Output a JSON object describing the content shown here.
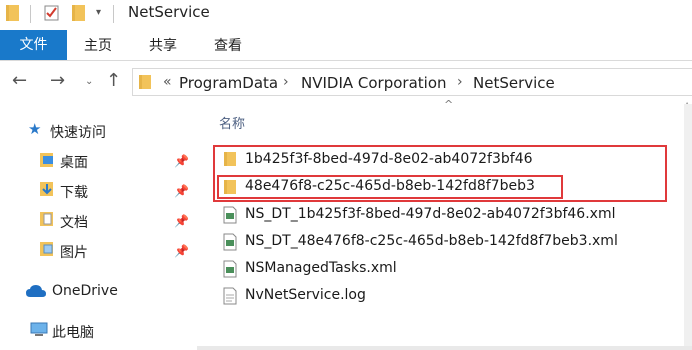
{
  "window": {
    "title": "NetService"
  },
  "ribbon": {
    "tabs": [
      {
        "label": "文件",
        "active": true
      },
      {
        "label": "主页"
      },
      {
        "label": "共享"
      },
      {
        "label": "查看"
      }
    ]
  },
  "address": {
    "overflow": "«",
    "crumbs": [
      "ProgramData",
      "NVIDIA Corporation",
      "NetService"
    ]
  },
  "nav_pane": {
    "quick_access": "快速访问",
    "pinned": [
      "桌面",
      "下载",
      "文档",
      "图片"
    ],
    "onedrive": "OneDrive",
    "this_pc": "此电脑"
  },
  "file_list": {
    "column_header": "名称",
    "items": [
      {
        "name": "1b425f3f-8bed-497d-8e02-ab4072f3bf46",
        "type": "folder",
        "highlighted": true
      },
      {
        "name": "48e476f8-c25c-465d-b8eb-142fd8f7beb3",
        "type": "folder",
        "highlighted": true
      },
      {
        "name": "NS_DT_1b425f3f-8bed-497d-8e02-ab4072f3bf46.xml",
        "type": "xml"
      },
      {
        "name": "NS_DT_48e476f8-c25c-465d-b8eb-142fd8f7beb3.xml",
        "type": "xml"
      },
      {
        "name": "NSManagedTasks.xml",
        "type": "xml"
      },
      {
        "name": "NvNetService.log",
        "type": "log"
      }
    ]
  },
  "colors": {
    "accent": "#1979ca",
    "folder": "#f2c35a",
    "highlight": "#e0393b",
    "nav_link": "#4d6082"
  },
  "icons": [
    "folder-icon",
    "checkbox-icon",
    "dropdown-arrow-icon",
    "back-arrow-icon",
    "forward-arrow-icon",
    "history-chevron-icon",
    "up-arrow-icon",
    "star-icon",
    "pin-icon",
    "cloud-icon",
    "computer-icon",
    "xml-file-icon",
    "text-file-icon"
  ]
}
